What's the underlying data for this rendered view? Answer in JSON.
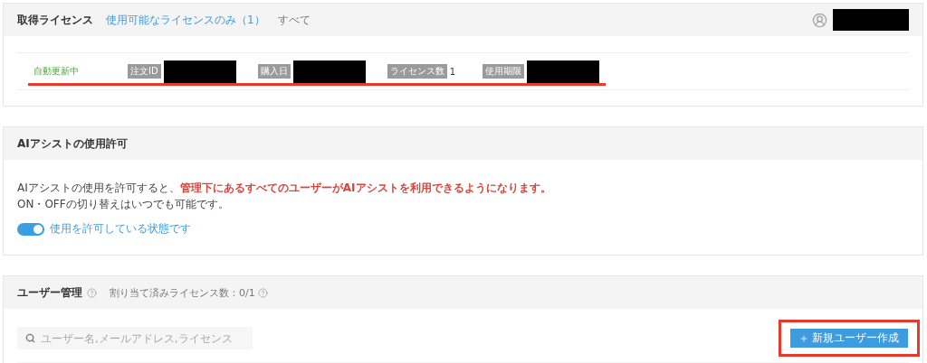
{
  "license_section": {
    "title": "取得ライセンス",
    "filters": [
      {
        "label": "使用可能なライセンスのみ（1）",
        "selected": true
      },
      {
        "label": "すべて",
        "selected": false
      }
    ],
    "licenses": [
      {
        "status": "自動更新中",
        "underlined": true,
        "fields": [
          {
            "label": "注文ID",
            "kind": "redacted"
          },
          {
            "label": "購入日",
            "kind": "redacted"
          },
          {
            "label": "ライセンス数",
            "kind": "value",
            "value": "1"
          },
          {
            "label": "使用期限",
            "kind": "redacted"
          }
        ]
      }
    ]
  },
  "ai_section": {
    "title": "AIアシストの使用許可",
    "description": [
      "AIアシストの使用を許可すると、**管理下にあるすべてのユーザーがAIアシストを利用できるようになります。**",
      "ON・OFFの切り替えはいつでも可能です。"
    ],
    "toggle": {
      "on": true,
      "label": "使用を許可している状態です"
    }
  },
  "user_section": {
    "title": "ユーザー管理",
    "assigned": "割り当て済みライセンス数：0/1",
    "search": {
      "placeholder": "ユーザー名,メールアドレス,ライセンス"
    },
    "create_button": {
      "label": "新規ユーザー作成",
      "highlighted": true
    }
  }
}
